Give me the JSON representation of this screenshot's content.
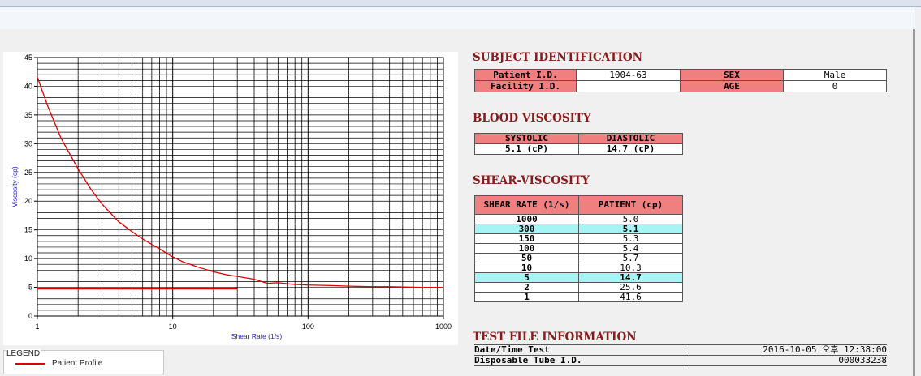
{
  "chart_data": {
    "type": "line",
    "xlabel": "Shear Rate (1/s)",
    "ylabel": "Viscosity (cp)",
    "x_scale": "log",
    "xlim": [
      1,
      1000
    ],
    "ylim": [
      0,
      45
    ],
    "x_ticks": [
      "1",
      "10",
      "100",
      "1000"
    ],
    "y_ticks": [
      "0",
      "5",
      "10",
      "15",
      "20",
      "25",
      "30",
      "35",
      "40",
      "45"
    ],
    "grid": true,
    "series": [
      {
        "name": "Patient Profile",
        "x": [
          1,
          1.2,
          1.5,
          2,
          2.5,
          3,
          4,
          5,
          6,
          7,
          8,
          10,
          12,
          15,
          20,
          25,
          30,
          40,
          50,
          60,
          80,
          100,
          150,
          200,
          300,
          400,
          500,
          700,
          1000
        ],
        "y": [
          41.6,
          36.4,
          30.9,
          25.6,
          22.0,
          19.5,
          16.4,
          14.7,
          13.4,
          12.5,
          11.7,
          10.3,
          9.4,
          8.6,
          7.7,
          7.2,
          6.9,
          6.4,
          5.7,
          5.8,
          5.5,
          5.4,
          5.3,
          5.2,
          5.1,
          5.1,
          5.05,
          5.0,
          5.0
        ],
        "color": "#e00000"
      },
      {
        "name": "",
        "x": [
          1,
          30
        ],
        "y": [
          4.8,
          4.8
        ],
        "color": "#d00000"
      }
    ]
  },
  "legend": {
    "title": "LEGEND",
    "items": [
      {
        "label": "Patient Profile",
        "color": "#e00000"
      }
    ]
  },
  "subject": {
    "heading": "SUBJECT IDENTIFICATION",
    "patient_id_label": "Patient I.D.",
    "patient_id_value": "1004-63",
    "sex_label": "SEX",
    "sex_value": "Male",
    "facility_id_label": "Facility I.D.",
    "facility_id_value": "",
    "age_label": "AGE",
    "age_value": "0"
  },
  "blood": {
    "heading": "BLOOD VISCOSITY",
    "systolic_label": "SYSTOLIC",
    "diastolic_label": "DIASTOLIC",
    "systolic_value": "5.1 (cP)",
    "diastolic_value": "14.7 (cP)"
  },
  "shear": {
    "heading": "SHEAR-VISCOSITY",
    "col1": "SHEAR RATE (1/s)",
    "col2": "PATIENT (cp)",
    "rows": [
      {
        "rate": "1000",
        "value": "5.0",
        "highlight": false
      },
      {
        "rate": "300",
        "value": "5.1",
        "highlight": true
      },
      {
        "rate": "150",
        "value": "5.3",
        "highlight": false
      },
      {
        "rate": "100",
        "value": "5.4",
        "highlight": false
      },
      {
        "rate": "50",
        "value": "5.7",
        "highlight": false
      },
      {
        "rate": "10",
        "value": "10.3",
        "highlight": false
      },
      {
        "rate": "5",
        "value": "14.7",
        "highlight": true
      },
      {
        "rate": "2",
        "value": "25.6",
        "highlight": false
      },
      {
        "rate": "1",
        "value": "41.6",
        "highlight": false
      }
    ]
  },
  "test_info": {
    "heading": "TEST FILE INFORMATION",
    "datetime_label": "Date/Time Test",
    "datetime_value": "2016-10-05  오후 12:38:00",
    "tube_label": "Disposable Tube I.D.",
    "tube_value": "000033238"
  },
  "colors": {
    "heading": "#8b1b1b",
    "header_cell": "#f08080",
    "highlight_row": "#a6f4f4",
    "curve": "#e00000"
  }
}
